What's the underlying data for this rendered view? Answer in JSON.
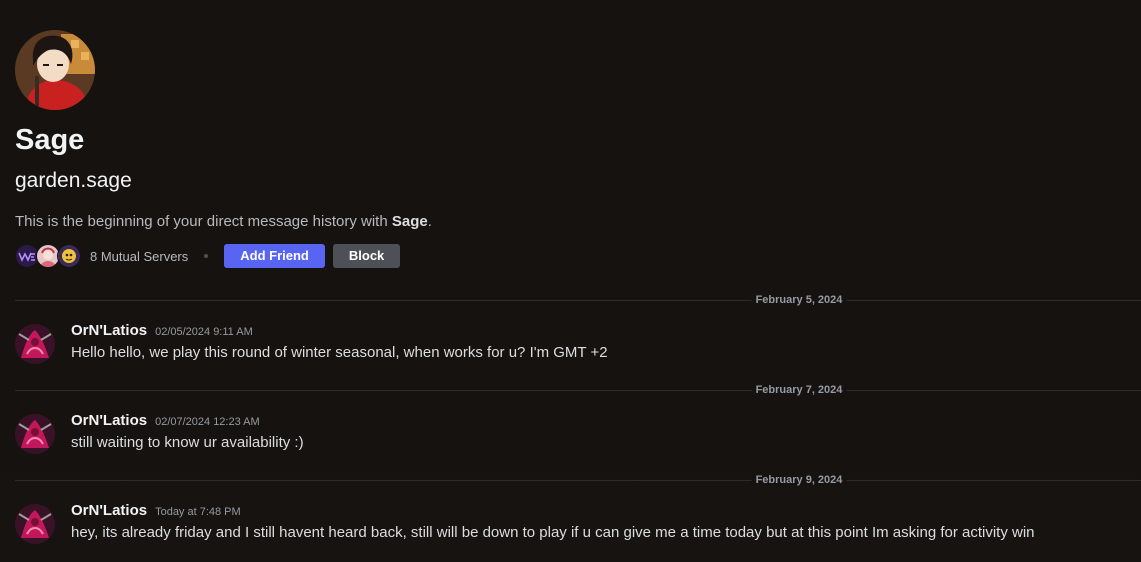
{
  "profile": {
    "display_name": "Sage",
    "username": "garden.sage",
    "beginning_prefix": "This is the beginning of your direct message history with ",
    "beginning_name": "Sage",
    "beginning_suffix": ".",
    "mutual_servers": "8 Mutual Servers",
    "add_friend_label": "Add Friend",
    "block_label": "Block"
  },
  "colors": {
    "background": "#161210",
    "accent": "#5865f2",
    "secondary_button": "#4e5058"
  },
  "messages": [
    {
      "date_divider": "February 5, 2024",
      "author": "OrN'Latios",
      "timestamp": "02/05/2024 9:11 AM",
      "content": "Hello hello, we play this round of winter seasonal, when works for u? I'm GMT +2"
    },
    {
      "date_divider": "February 7, 2024",
      "author": "OrN'Latios",
      "timestamp": "02/07/2024 12:23 AM",
      "content": "still waiting to know ur availability :)"
    },
    {
      "date_divider": "February 9, 2024",
      "author": "OrN'Latios",
      "timestamp": "Today at 7:48 PM",
      "content": "hey, its already friday and I still havent heard back, still will be down to play if u can give me a time today but at this point Im asking for activity win"
    }
  ]
}
